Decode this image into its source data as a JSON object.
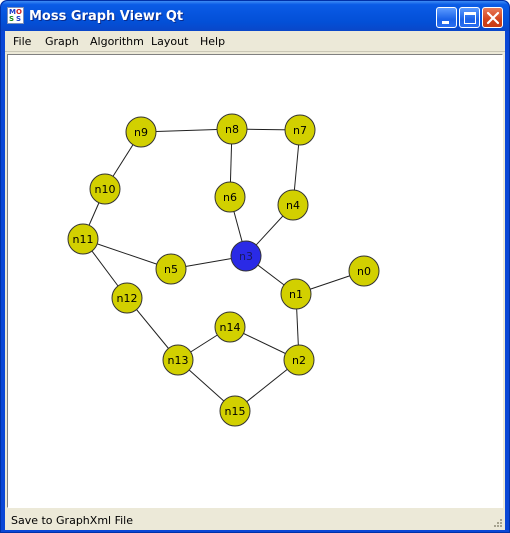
{
  "window": {
    "title": "Moss Graph Viewr Qt",
    "icon": "app-icon",
    "controls": [
      "minimize-icon",
      "maximize-icon",
      "close-icon"
    ]
  },
  "menu": {
    "file": "File",
    "graph": "Graph",
    "algorithm": "Algorithm",
    "layout": "Layout",
    "help": "Help"
  },
  "colors": {
    "node_fill": "#d2d000",
    "node_stroke": "#333333",
    "selected_fill": "#2a2ae6",
    "edge": "#202020",
    "titlebar": "#0a5ce6"
  },
  "graph": {
    "selected": "n3",
    "nodes": [
      {
        "id": "n0",
        "label": "n0"
      },
      {
        "id": "n1",
        "label": "n1"
      },
      {
        "id": "n2",
        "label": "n2"
      },
      {
        "id": "n3",
        "label": "n3"
      },
      {
        "id": "n4",
        "label": "n4"
      },
      {
        "id": "n5",
        "label": "n5"
      },
      {
        "id": "n6",
        "label": "n6"
      },
      {
        "id": "n7",
        "label": "n7"
      },
      {
        "id": "n8",
        "label": "n8"
      },
      {
        "id": "n9",
        "label": "n9"
      },
      {
        "id": "n10",
        "label": "n10"
      },
      {
        "id": "n11",
        "label": "n11"
      },
      {
        "id": "n12",
        "label": "n12"
      },
      {
        "id": "n13",
        "label": "n13"
      },
      {
        "id": "n14",
        "label": "n14"
      },
      {
        "id": "n15",
        "label": "n15"
      }
    ],
    "edges": [
      [
        "n9",
        "n8"
      ],
      [
        "n8",
        "n7"
      ],
      [
        "n9",
        "n10"
      ],
      [
        "n8",
        "n6"
      ],
      [
        "n7",
        "n4"
      ],
      [
        "n10",
        "n11"
      ],
      [
        "n6",
        "n3"
      ],
      [
        "n4",
        "n3"
      ],
      [
        "n11",
        "n5"
      ],
      [
        "n5",
        "n3"
      ],
      [
        "n11",
        "n12"
      ],
      [
        "n3",
        "n1"
      ],
      [
        "n1",
        "n0"
      ],
      [
        "n1",
        "n2"
      ],
      [
        "n12",
        "n13"
      ],
      [
        "n13",
        "n14"
      ],
      [
        "n14",
        "n2"
      ],
      [
        "n13",
        "n15"
      ],
      [
        "n15",
        "n2"
      ]
    ]
  },
  "status": {
    "message": "Save to GraphXml File"
  }
}
